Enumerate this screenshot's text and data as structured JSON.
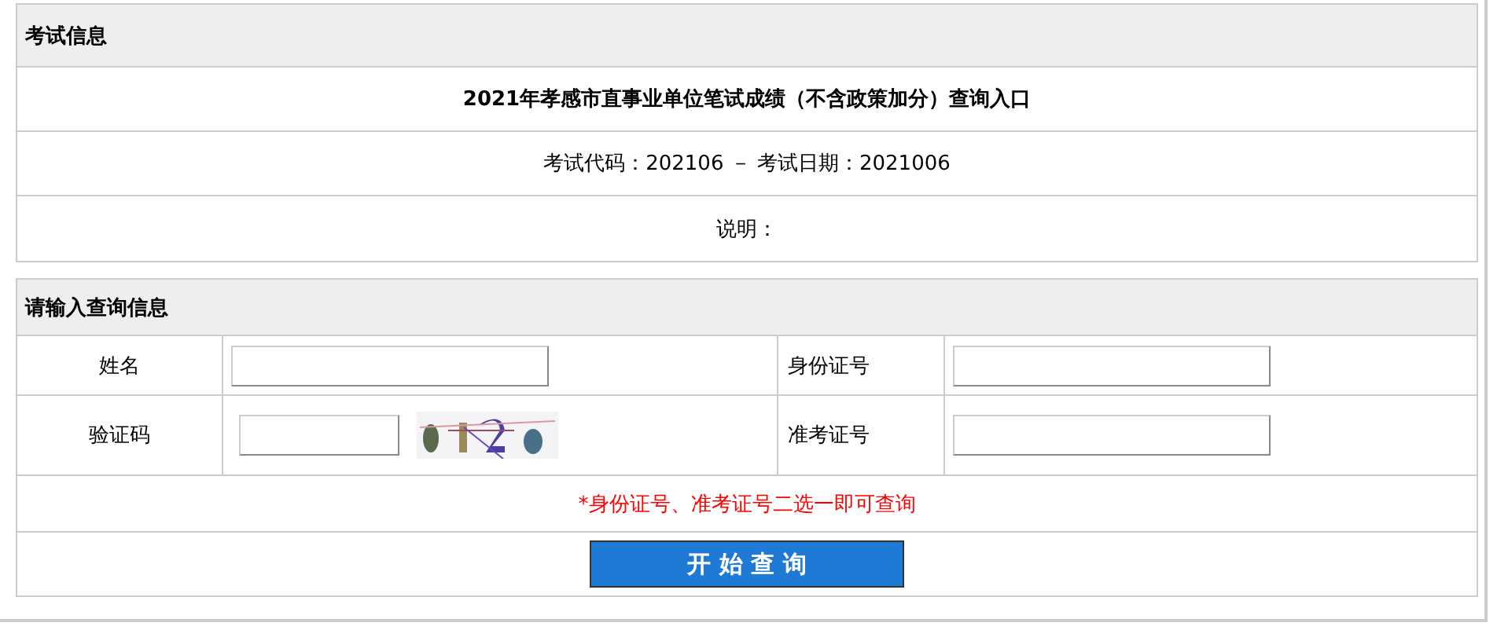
{
  "exam_info": {
    "heading": "考试信息",
    "title": "2021年孝感市直事业单位笔试成绩（不含政策加分）查询入口",
    "code_line": "考试代码：202106 － 考试日期：2021006",
    "note": "说明："
  },
  "query": {
    "heading": "请输入查询信息",
    "fields": [
      {
        "label": "姓名",
        "kind": "text"
      },
      {
        "label": "身份证号",
        "kind": "text"
      },
      {
        "label": "验证码",
        "kind": "captcha"
      },
      {
        "label": "准考证号",
        "kind": "text"
      }
    ],
    "hint": "*身份证号、准考证号二选一即可查询",
    "submit": "开 始 查 询"
  }
}
